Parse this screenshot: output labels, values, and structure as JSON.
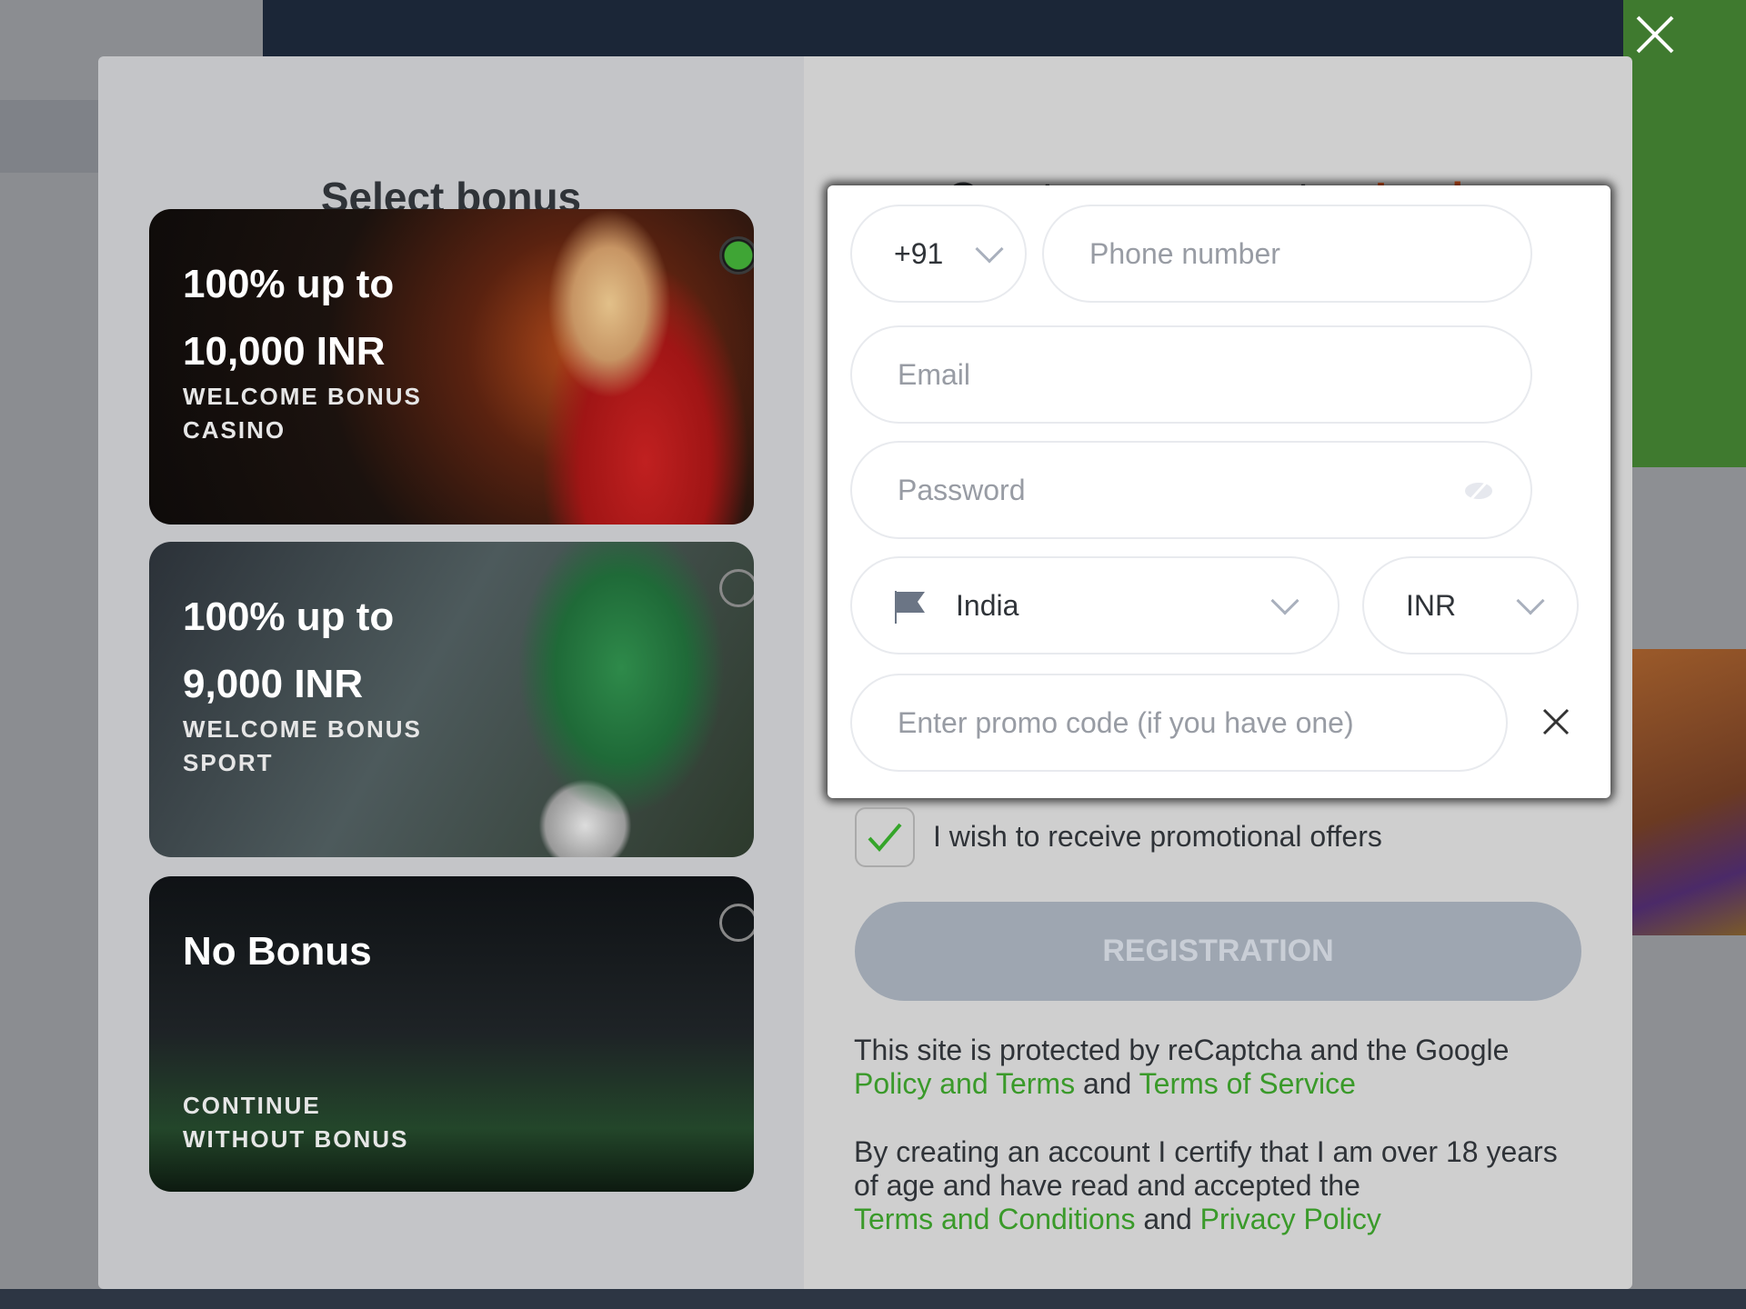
{
  "left": {
    "title": "Select bonus",
    "cards": [
      {
        "amount_line1": "100% up to",
        "amount_line2": "10,000 INR",
        "label_line1": "WELCOME BONUS",
        "label_line2": "CASINO",
        "selected": true
      },
      {
        "amount_line1": "100% up to",
        "amount_line2": "9,000 INR",
        "label_line1": "WELCOME BONUS",
        "label_line2": "SPORT",
        "selected": false
      },
      {
        "amount_line1": "No Bonus",
        "label_line1": "CONTINUE",
        "label_line2": "WITHOUT BONUS",
        "selected": false
      }
    ]
  },
  "right": {
    "title_prefix": "Create an account or",
    "login_link": "Login",
    "form": {
      "country_code": "+91",
      "phone_placeholder": "Phone number",
      "email_placeholder": "Email",
      "password_placeholder": "Password",
      "country": "India",
      "currency": "INR",
      "promo_placeholder": "Enter promo code (if you have one)"
    },
    "promo_checkbox": {
      "label": "I wish to receive promotional offers",
      "checked": true
    },
    "register_button": "REGISTRATION",
    "recaptcha": {
      "text": "This site is protected by reCaptcha and the Google",
      "link1": "Policy and Terms",
      "and": "and",
      "link2": "Terms of Service"
    },
    "terms": {
      "text": "By creating an account I certify that I am over 18 years of age and have read and accepted the",
      "link1": "Terms and Conditions",
      "and": "and",
      "link2": "Privacy Policy"
    }
  },
  "colors": {
    "accent_login": "#e0561a",
    "link_green": "#3a9a2a",
    "selected_radio": "#3fa535"
  }
}
